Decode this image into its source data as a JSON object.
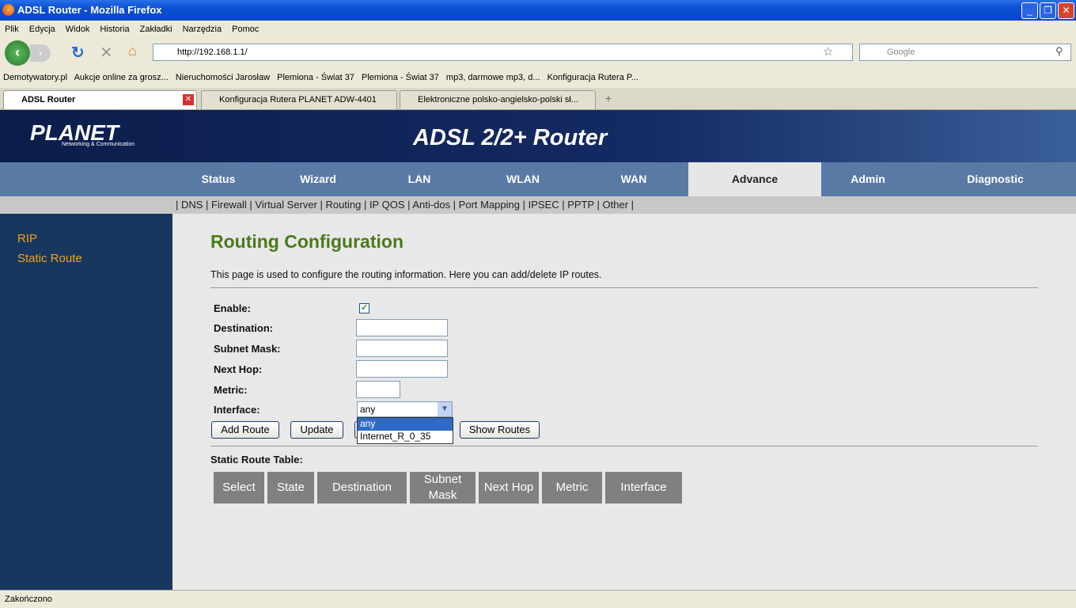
{
  "window": {
    "title": "ADSL Router - Mozilla Firefox"
  },
  "menu": [
    "Plik",
    "Edycja",
    "Widok",
    "Historia",
    "Zakładki",
    "Narzędzia",
    "Pomoc"
  ],
  "url": "http://192.168.1.1/",
  "search_placeholder": "Google",
  "bookmarks": [
    "Demotywatory.pl",
    "Aukcje online za grosz...",
    "Nieruchomości Jarosław",
    "Plemiona - Świat 37",
    "Plemiona - Świat 37",
    "mp3, darmowe mp3, d...",
    "Konfiguracja Rutera P..."
  ],
  "tabs": [
    "ADSL Router",
    "Konfiguracja Rutera PLANET ADW-4401",
    "Elektroniczne polsko-angielsko-polski sł..."
  ],
  "header": {
    "logo": "PLANET",
    "logo_sub": "Networking & Communication",
    "title": "ADSL 2/2+ Router"
  },
  "nav": [
    "Status",
    "Wizard",
    "LAN",
    "WLAN",
    "WAN",
    "Advance",
    "Admin",
    "Diagnostic"
  ],
  "subnav": "| DNS | Firewall | Virtual Server | Routing | IP QOS | Anti-dos | Port Mapping | IPSEC | PPTP | Other |",
  "sidebar": [
    "RIP",
    "Static Route"
  ],
  "page": {
    "title": "Routing Configuration",
    "description": "This page is used to configure the routing information. Here you can add/delete IP routes.",
    "labels": {
      "enable": "Enable:",
      "destination": "Destination:",
      "subnet": "Subnet Mask:",
      "nexthop": "Next Hop:",
      "metric": "Metric:",
      "interface": "Interface:"
    },
    "enable_checked": true,
    "interface_value": "any",
    "interface_options": [
      "any",
      "Internet_R_0_35"
    ],
    "buttons": {
      "add": "Add Route",
      "update": "Update",
      "show": "Show Routes"
    },
    "table_title": "Static Route Table:",
    "table_headers": [
      "Select",
      "State",
      "Destination",
      "Subnet Mask",
      "Next Hop",
      "Metric",
      "Interface"
    ]
  },
  "status": "Zakończono"
}
